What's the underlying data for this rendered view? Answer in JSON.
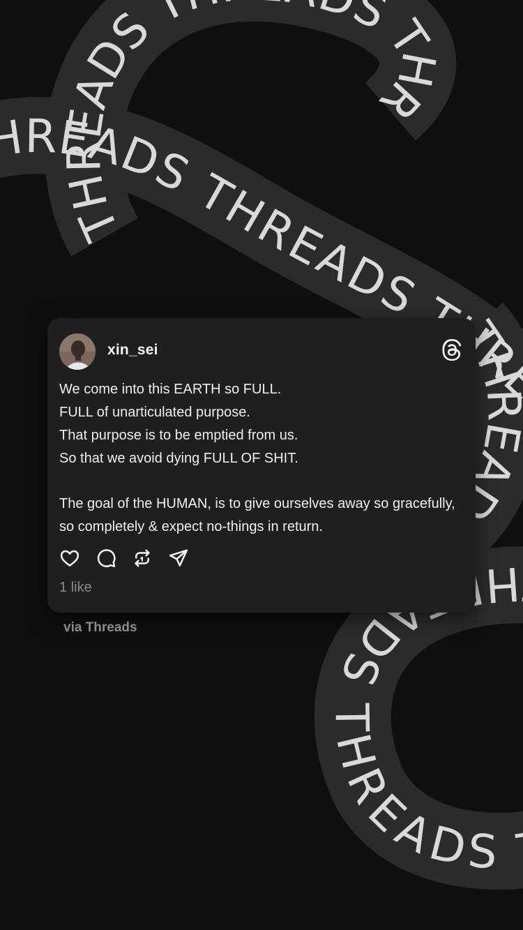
{
  "background": {
    "ribbon_text": "THREADS THREADS THREADS THREADS THREADS THREADS THREADS",
    "colors": {
      "page": "#0f0f0f",
      "ribbon": "#2b2b2b",
      "ribbon_text": "#d9d9d9"
    }
  },
  "post": {
    "username": "xin_sei",
    "avatar_icon": "profile-photo",
    "brand_icon": "threads-logo-icon",
    "lines": [
      "We come into this EARTH so FULL.",
      "FULL of unarticulated purpose.",
      "That purpose is to be emptied from us.",
      "So that we avoid dying FULL OF SHIT."
    ],
    "paragraph2": "The goal of the HUMAN, is to give ourselves away so gracefully, so completely & expect no-things in return.",
    "actions": [
      "heart-icon",
      "comment-icon",
      "repost-icon",
      "share-icon"
    ],
    "likes_label": "1 like",
    "colors": {
      "card": "#1f1f1f",
      "text": "#efefef",
      "muted": "#8a8a8a"
    }
  },
  "footer": {
    "via_label": "via Threads"
  }
}
